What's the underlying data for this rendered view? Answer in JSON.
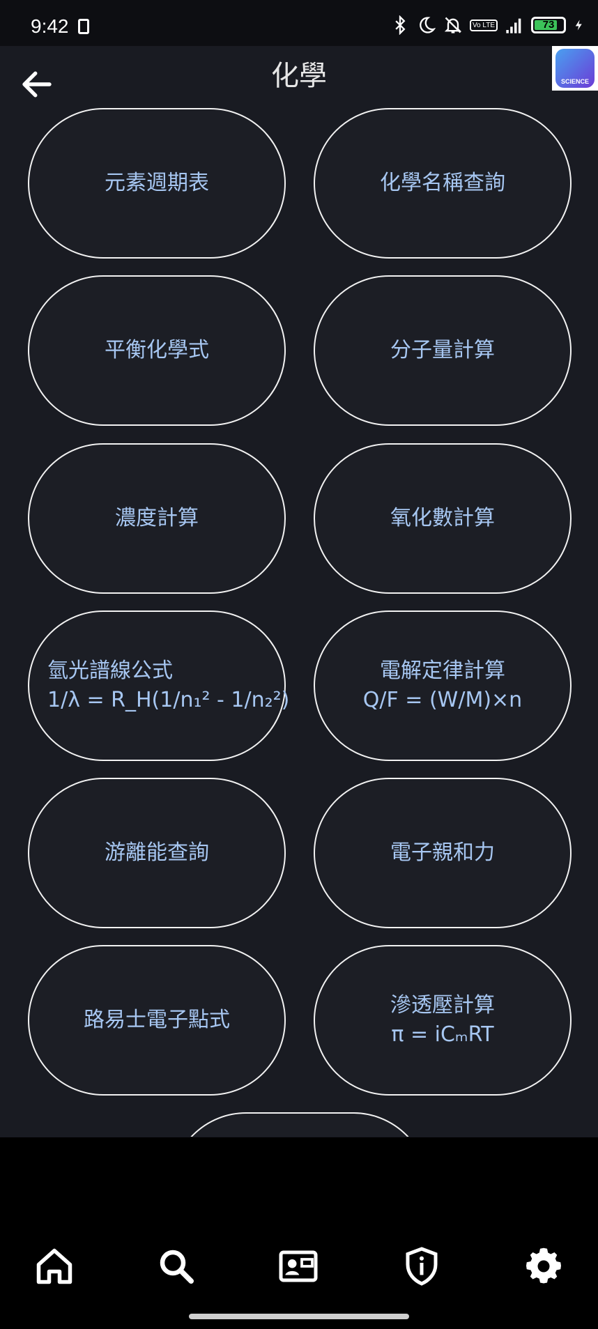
{
  "status_bar": {
    "time": "9:42",
    "volte": "Vo LTE",
    "battery": "73"
  },
  "header": {
    "title": "化學",
    "logo_text": "SCIENCE"
  },
  "tiles": [
    {
      "line1": "元素週期表"
    },
    {
      "line1": "化學名稱查詢"
    },
    {
      "line1": "平衡化學式"
    },
    {
      "line1": "分子量計算"
    },
    {
      "line1": "濃度計算"
    },
    {
      "line1": "氧化數計算"
    },
    {
      "line1": "氫光譜線公式",
      "line2": "1/λ = R_H(1/n₁² - 1/n₂²)"
    },
    {
      "line1": "電解定律計算",
      "line2": "Q/F = (W/M)×n"
    },
    {
      "line1": "游離能查詢"
    },
    {
      "line1": "電子親和力"
    },
    {
      "line1": "路易士電子點式"
    },
    {
      "line1": "滲透壓計算",
      "line2": "π = iCₘRT"
    }
  ],
  "bottom_nav": {
    "icons": [
      "home-icon",
      "search-icon",
      "contact-card-icon",
      "shield-info-icon",
      "settings-gear-icon"
    ]
  },
  "colors": {
    "background": "#191b22",
    "tile_text": "#a7c7f2",
    "tile_border": "#f2f2f2",
    "nav_background": "#000000"
  }
}
